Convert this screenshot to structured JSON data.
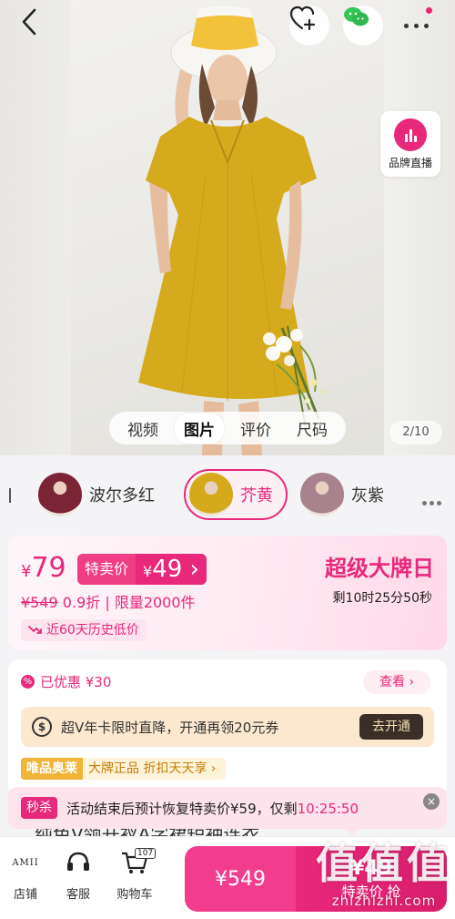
{
  "media": {
    "tabs": [
      "视频",
      "图片",
      "评价",
      "尺码"
    ],
    "active_tab": "图片",
    "counter": "2/10",
    "live_label": "品牌直播"
  },
  "colors": {
    "options": [
      {
        "name": "波尔多红",
        "swatch": "#7a2436"
      },
      {
        "name": "芥黄",
        "swatch": "#d4a91c",
        "selected": true
      },
      {
        "name": "灰紫",
        "swatch": "#a8838d"
      }
    ]
  },
  "price": {
    "current_symbol": "¥",
    "current_value": "79",
    "sale_label": "特卖价",
    "sale_symbol": "¥",
    "sale_value": "49",
    "original": "¥549",
    "detail": " 0.9折 | 限量2000件",
    "history": "近60天历史低价",
    "brand_title": "超级大牌日",
    "countdown": "剩10时25分50秒"
  },
  "coupon": {
    "discount": "已优惠 ¥30",
    "view": "查看",
    "vip_text": "超V年卡限时直降，开通再领20元券",
    "vip_button": "去开通",
    "auth_badge": "唯品奥莱",
    "auth_text": "大牌正品 折扣天天享"
  },
  "flash": {
    "tag": "秒杀",
    "text": "活动结束后预计恢复特卖价¥59，仅剩",
    "time": "10:25:50",
    "partial_title": "纯色V领开衩A字裙短袖连衣"
  },
  "bottom": {
    "store": {
      "logo": "AMII",
      "label": "店铺"
    },
    "service": {
      "label": "客服"
    },
    "cart": {
      "label": "购物车",
      "count": "107"
    },
    "buy_original": "¥549",
    "buy_sale": "¥49",
    "buy_sale_label": "特卖价 抢",
    "watermark": "值值值",
    "watermark_url": "zhizhizhi.com"
  },
  "theme": {
    "accent": "#e8287a",
    "gold": "#f0b436"
  }
}
